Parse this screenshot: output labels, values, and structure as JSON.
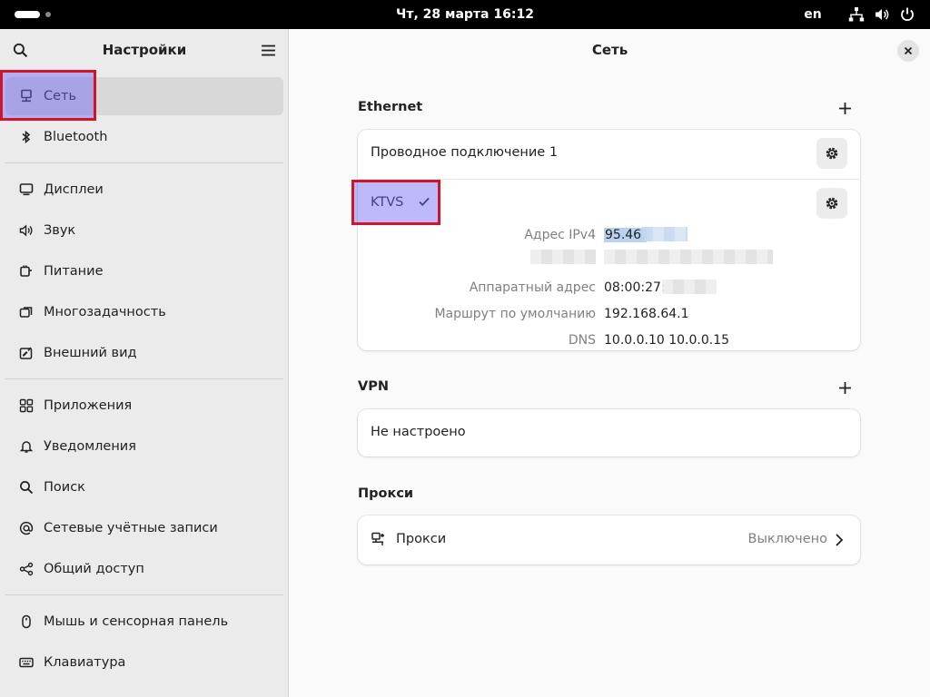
{
  "topbar": {
    "clock": "Чт, 28 марта  16:12",
    "language": "en",
    "icons": [
      "network-wired-icon",
      "volume-icon",
      "power-icon"
    ]
  },
  "sidebar": {
    "title": "Настройки",
    "items": [
      {
        "label": "Сеть",
        "icon": "network-icon",
        "selected": true
      },
      {
        "label": "Bluetooth",
        "icon": "bluetooth-icon"
      },
      {
        "label": "Дисплеи",
        "icon": "display-icon"
      },
      {
        "label": "Звук",
        "icon": "sound-icon"
      },
      {
        "label": "Питание",
        "icon": "power-plug-icon"
      },
      {
        "label": "Многозадачность",
        "icon": "multitasking-icon"
      },
      {
        "label": "Внешний вид",
        "icon": "appearance-icon"
      },
      {
        "label": "Приложения",
        "icon": "apps-grid-icon"
      },
      {
        "label": "Уведомления",
        "icon": "bell-icon"
      },
      {
        "label": "Поиск",
        "icon": "search-icon"
      },
      {
        "label": "Сетевые учётные записи",
        "icon": "online-accounts-icon"
      },
      {
        "label": "Общий доступ",
        "icon": "share-icon"
      },
      {
        "label": "Мышь и сенсорная панель",
        "icon": "mouse-icon"
      },
      {
        "label": "Клавиатура",
        "icon": "keyboard-icon"
      }
    ]
  },
  "main": {
    "title": "Сеть",
    "ethernet": {
      "title": "Ethernet",
      "connection_1": "Проводное подключение 1",
      "active_connection": "KTVS",
      "details": {
        "ipv4_label": "Адрес IPv4",
        "ipv4_value": "95.46.",
        "hw_label": "Аппаратный адрес",
        "hw_value": "08:00:27:",
        "route_label": "Маршрут по умолчанию",
        "route_value": "192.168.64.1",
        "dns_label": "DNS",
        "dns_value": "10.0.0.10 10.0.0.15"
      }
    },
    "vpn": {
      "title": "VPN",
      "status": "Не настроено"
    },
    "proxy": {
      "title": "Прокси",
      "label": "Прокси",
      "status": "Выключено"
    }
  },
  "colors": {
    "highlight_border": "#d0142c",
    "highlight_fill": "#6e64f5",
    "selection": "#3584e4"
  }
}
